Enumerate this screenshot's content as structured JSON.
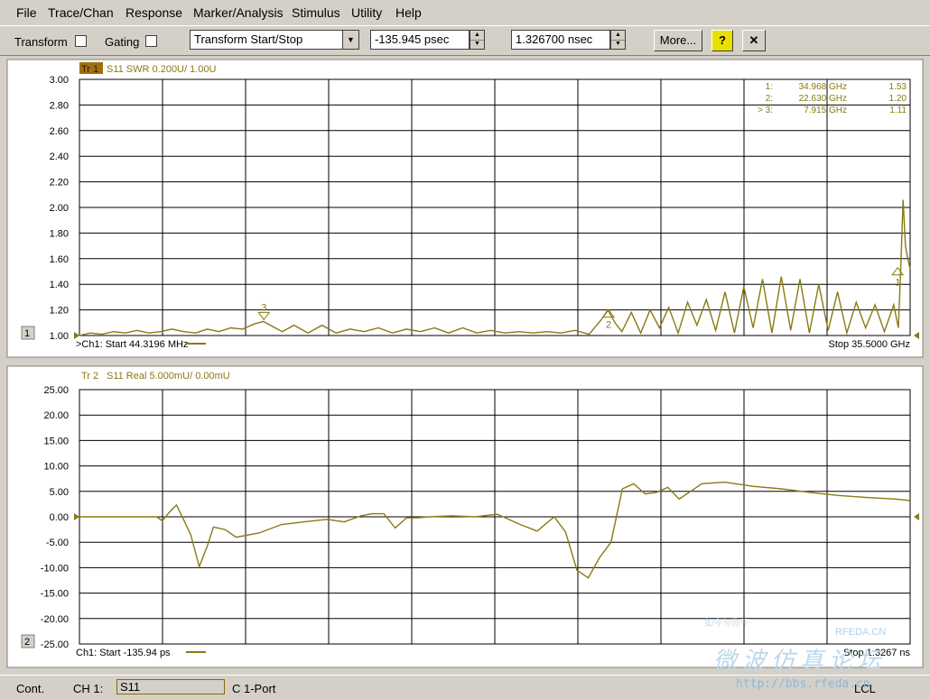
{
  "menu": [
    "File",
    "Trace/Chan",
    "Response",
    "Marker/Analysis",
    "Stimulus",
    "Utility",
    "Help"
  ],
  "toolbar": {
    "transform_label": "Transform",
    "gating_label": "Gating",
    "mode_value": "Transform Start/Stop",
    "start_value": "-135.945 psec",
    "stop_value": "1.326700 nsec",
    "more_label": "More...",
    "help_icon": "?",
    "close_icon": "✕"
  },
  "status": {
    "cont": "Cont.",
    "channel": "CH 1:",
    "measurement": "S11",
    "mode": "C  1-Port",
    "lcl": "LCL"
  },
  "watermark": {
    "site": "RFEDA.CN",
    "url": "http://bbs.rfeda.cn",
    "cn_large": "微波仿真论坛",
    "cn_small": "如今与你干"
  },
  "colors": {
    "grid_bg": "#ffffff",
    "trace": "#8a7a12",
    "grid_line": "#000000",
    "marker_table": "#8a7a12",
    "title_badge": "#a07010"
  },
  "chart_data": [
    {
      "type": "line",
      "window_number": "1",
      "trace_badge": "Tr 1",
      "title": "S11 SWR 0.200U/  1.00U",
      "xlabel_start": ">Ch1: Start  44.3196 MHz",
      "xlabel_stop": "Stop  35.5000 GHz",
      "x_unit": "GHz",
      "xlim": [
        0.0443196,
        35.5
      ],
      "ylim": [
        1.0,
        3.0
      ],
      "yticks": [
        "3.00",
        "2.80",
        "2.60",
        "2.40",
        "2.20",
        "2.00",
        "1.80",
        "1.60",
        "1.40",
        "1.20",
        "1.00"
      ],
      "grid": true,
      "markers": [
        {
          "id": "1",
          "label": "1:",
          "freq": "34.968 GHz",
          "value": "1.53",
          "x": 34.968,
          "y": 1.53
        },
        {
          "id": "2",
          "label": "2:",
          "freq": "22.630 GHz",
          "value": "1.20",
          "x": 22.63,
          "y": 1.2
        },
        {
          "id": "3",
          "label": "> 3:",
          "freq": "7.915 GHz",
          "value": "1.11",
          "x": 7.915,
          "y": 1.11
        }
      ],
      "series": [
        {
          "x": [
            0.04,
            0.5,
            1.0,
            1.5,
            2.0,
            2.5,
            3.0,
            3.5,
            4.0,
            4.5,
            5.0,
            5.5,
            6.0,
            6.5,
            7.0,
            7.5,
            7.9,
            8.3,
            8.7,
            9.2,
            9.8,
            10.4,
            11.0,
            11.6,
            12.2,
            12.8,
            13.4,
            14.0,
            14.6,
            15.2,
            15.8,
            16.4,
            17.0,
            17.6,
            18.2,
            18.8,
            19.4,
            20.0,
            20.6,
            21.2,
            21.8,
            22.3,
            22.6,
            22.9,
            23.2,
            23.6,
            24.0,
            24.4,
            24.8,
            25.2,
            25.6,
            26.0,
            26.4,
            26.8,
            27.2,
            27.6,
            28.0,
            28.4,
            28.8,
            29.2,
            29.6,
            30.0,
            30.4,
            30.8,
            31.2,
            31.6,
            32.0,
            32.4,
            32.8,
            33.2,
            33.6,
            34.0,
            34.4,
            34.8,
            35.0,
            35.1,
            35.2,
            35.3,
            35.4,
            35.5
          ],
          "values": [
            1.0,
            1.02,
            1.01,
            1.03,
            1.02,
            1.04,
            1.02,
            1.03,
            1.05,
            1.03,
            1.02,
            1.05,
            1.03,
            1.06,
            1.05,
            1.09,
            1.11,
            1.07,
            1.03,
            1.08,
            1.02,
            1.08,
            1.02,
            1.05,
            1.03,
            1.06,
            1.02,
            1.05,
            1.03,
            1.06,
            1.02,
            1.06,
            1.02,
            1.04,
            1.02,
            1.03,
            1.02,
            1.03,
            1.02,
            1.04,
            1.01,
            1.12,
            1.2,
            1.1,
            1.03,
            1.18,
            1.02,
            1.2,
            1.06,
            1.22,
            1.02,
            1.26,
            1.08,
            1.28,
            1.04,
            1.34,
            1.02,
            1.38,
            1.06,
            1.44,
            1.02,
            1.46,
            1.04,
            1.44,
            1.02,
            1.4,
            1.04,
            1.34,
            1.02,
            1.26,
            1.06,
            1.24,
            1.03,
            1.24,
            1.06,
            1.53,
            2.06,
            1.7,
            1.6,
            1.52
          ]
        }
      ]
    },
    {
      "type": "line",
      "window_number": "2",
      "trace_badge": "Tr 2",
      "title": "S11 Real 5.000mU/  0.00mU",
      "xlabel_start": "Ch1: Start  -135.94 ps",
      "xlabel_stop": "Stop  1.3267 ns",
      "x_unit": "ns",
      "xlim": [
        -0.13594,
        1.3267
      ],
      "ylim": [
        -25.0,
        25.0
      ],
      "yticks": [
        "25.00",
        "20.00",
        "15.00",
        "10.00",
        "5.00",
        "0.00",
        "-5.00",
        "-10.00",
        "-15.00",
        "-20.00",
        "-25.00"
      ],
      "grid": true,
      "series": [
        {
          "x": [
            -0.136,
            -0.05,
            0.0,
            0.01,
            0.02,
            0.03,
            0.035,
            0.045,
            0.06,
            0.075,
            0.09,
            0.1,
            0.12,
            0.14,
            0.18,
            0.22,
            0.26,
            0.3,
            0.33,
            0.36,
            0.38,
            0.4,
            0.42,
            0.44,
            0.46,
            0.48,
            0.52,
            0.56,
            0.6,
            0.64,
            0.67,
            0.7,
            0.72,
            0.74,
            0.76,
            0.78,
            0.8,
            0.82,
            0.84,
            0.86,
            0.88,
            0.9,
            0.92,
            0.94,
            0.96,
            1.0,
            1.05,
            1.1,
            1.15,
            1.2,
            1.25,
            1.3,
            1.3267
          ],
          "values": [
            0.0,
            0.0,
            0.0,
            -0.8,
            0.6,
            1.8,
            2.3,
            0.0,
            -3.5,
            -9.8,
            -5.5,
            -2.0,
            -2.5,
            -4.0,
            -3.2,
            -1.5,
            -1.0,
            -0.5,
            -1.0,
            0.2,
            0.6,
            0.6,
            -2.2,
            -0.2,
            -0.2,
            0.0,
            0.2,
            0.0,
            0.5,
            -1.5,
            -2.8,
            0.0,
            -3.0,
            -10.5,
            -12.0,
            -8.0,
            -5.0,
            5.5,
            6.5,
            4.5,
            4.8,
            5.8,
            3.5,
            5.0,
            6.5,
            6.8,
            6.0,
            5.5,
            4.8,
            4.2,
            3.8,
            3.5,
            3.2
          ]
        }
      ]
    }
  ]
}
